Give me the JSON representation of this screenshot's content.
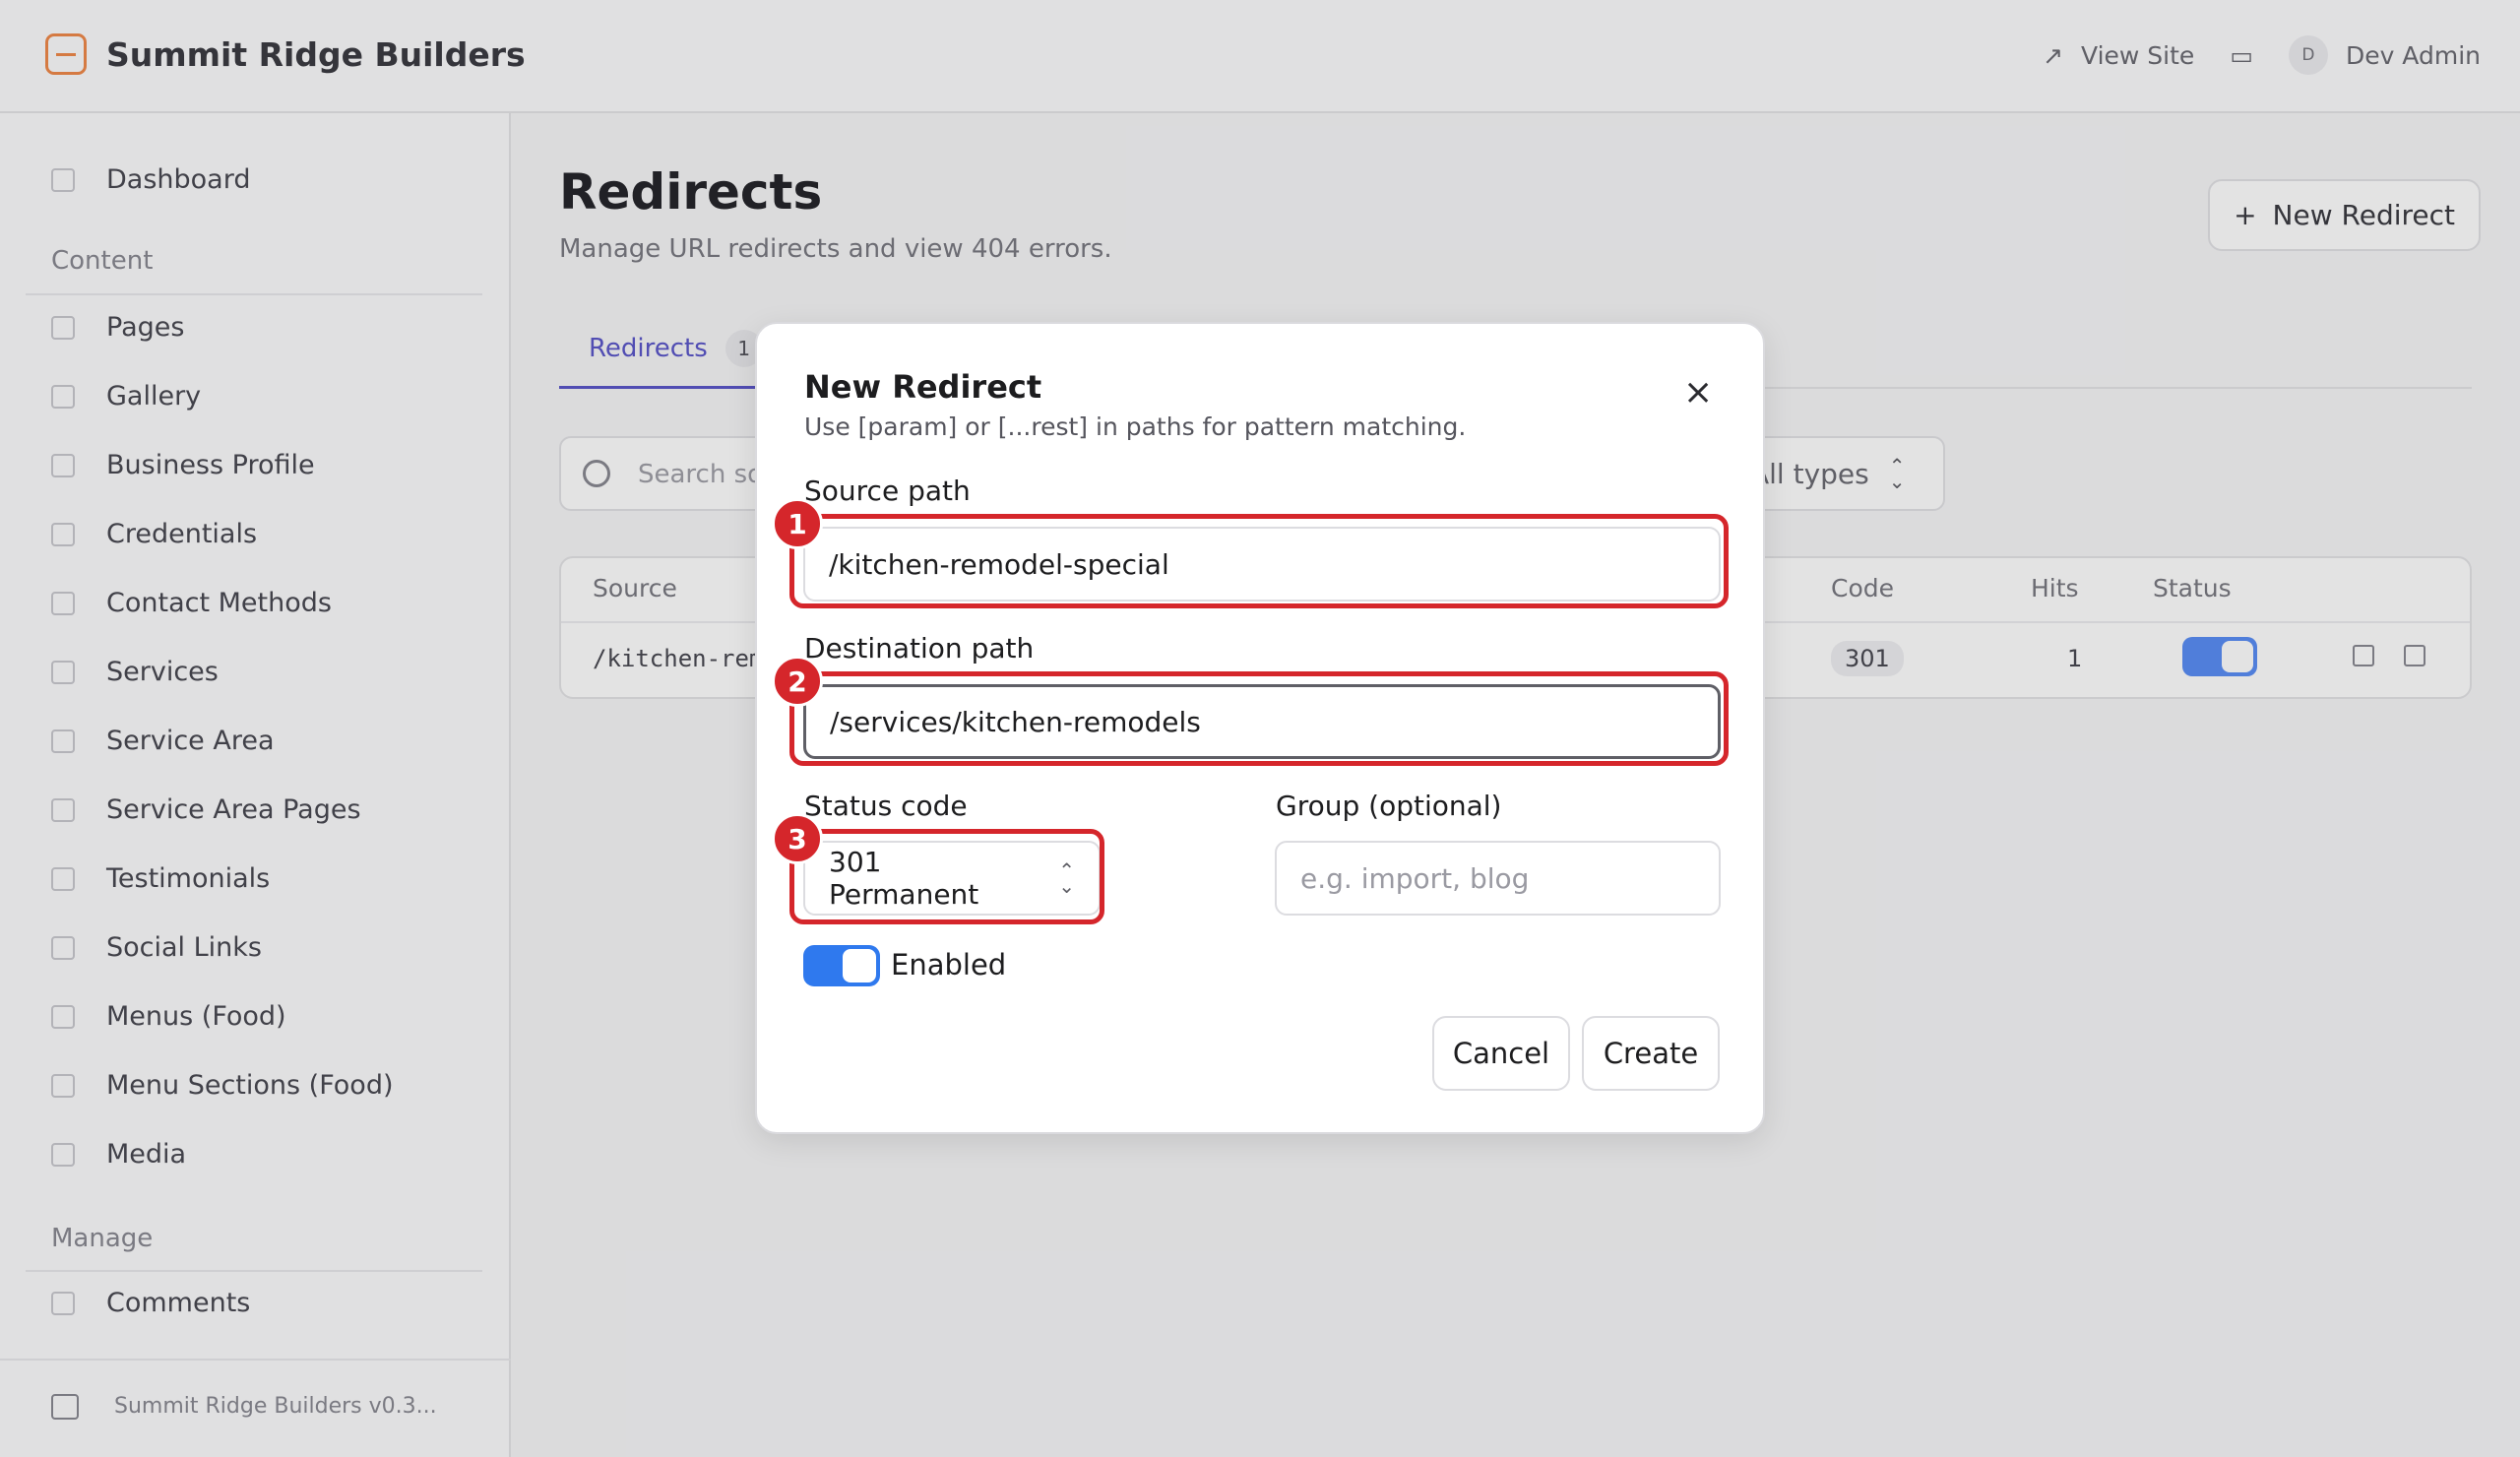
{
  "app": {
    "brand": "Summit Ridge Builders",
    "view_site": "View Site",
    "user_initial": "D",
    "user_name": "Dev Admin",
    "version": "Summit Ridge Builders v0.3..."
  },
  "sidebar": {
    "dashboard": "Dashboard",
    "section_content": "Content",
    "items": [
      "Pages",
      "Gallery",
      "Business Profile",
      "Credentials",
      "Contact Methods",
      "Services",
      "Service Area",
      "Service Area Pages",
      "Testimonials",
      "Social Links",
      "Menus (Food)",
      "Menu Sections (Food)",
      "Media"
    ],
    "section_manage": "Manage",
    "comments": "Comments"
  },
  "page": {
    "title": "Redirects",
    "subtitle": "Manage URL redirects and view 404 errors.",
    "new_button": "New Redirect",
    "tab_label": "Redirects",
    "tab_count": "1",
    "search_placeholder": "Search so",
    "type_filter": "All types"
  },
  "table": {
    "columns": {
      "source": "Source",
      "code": "Code",
      "hits": "Hits",
      "status": "Status"
    },
    "row": {
      "source": "/kitchen-rem",
      "code": "301",
      "hits": "1",
      "enabled": true
    }
  },
  "modal": {
    "title": "New Redirect",
    "description": "Use [param] or [...rest] in paths for pattern matching.",
    "source_label": "Source path",
    "source_value": "/kitchen-remodel-special",
    "dest_label": "Destination path",
    "dest_value": "/services/kitchen-remodels",
    "status_label": "Status code",
    "status_value": "301 Permanent",
    "group_label": "Group (optional)",
    "group_placeholder": "e.g. import, blog",
    "enabled_label": "Enabled",
    "enabled": true,
    "cancel": "Cancel",
    "create": "Create"
  },
  "annotations": [
    "1",
    "2",
    "3"
  ],
  "colors": {
    "accent": "#2f79ee",
    "highlight": "#d5262b",
    "brand": "#f08a4b",
    "tab": "#5b57c9"
  }
}
